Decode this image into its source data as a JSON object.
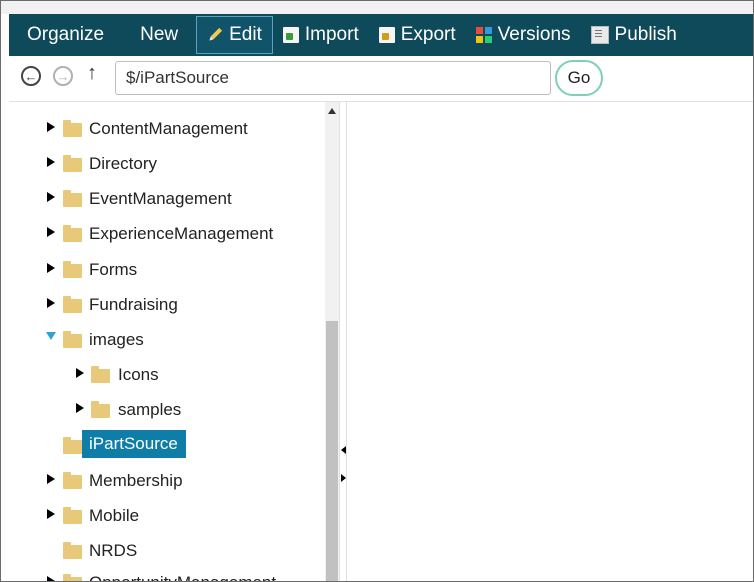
{
  "toolbar": {
    "organize": "Organize",
    "new": "New",
    "edit": "Edit",
    "import": "Import",
    "export": "Export",
    "versions": "Versions",
    "publish": "Publish"
  },
  "address": {
    "path": "$/iPartSource",
    "go": "Go"
  },
  "tree": {
    "items": [
      {
        "label": "ContentManagement"
      },
      {
        "label": "Directory"
      },
      {
        "label": "EventManagement"
      },
      {
        "label": "ExperienceManagement"
      },
      {
        "label": "Forms"
      },
      {
        "label": "Fundraising"
      },
      {
        "label": "images"
      },
      {
        "label": "Icons"
      },
      {
        "label": "samples"
      },
      {
        "label": "iPartSource"
      },
      {
        "label": "Membership"
      },
      {
        "label": "Mobile"
      },
      {
        "label": "NRDS"
      },
      {
        "label": "OpportunityManagement"
      }
    ]
  },
  "colors": {
    "toolbar_bg": "#0f4a5a",
    "selected_bg": "#0e7ea8",
    "folder": "#e8c97a",
    "expand_arrow": "#2fa4d3",
    "go_border": "#7fcfb6"
  }
}
